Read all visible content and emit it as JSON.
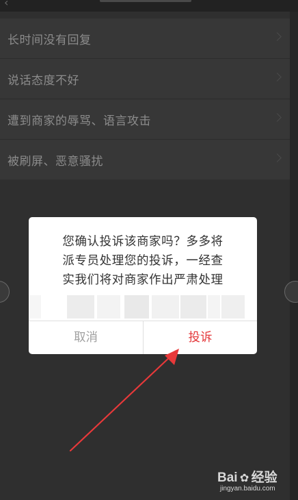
{
  "complaint_list": {
    "items": [
      {
        "label": "长时间没有回复"
      },
      {
        "label": "说话态度不好"
      },
      {
        "label": "遭到商家的辱骂、语言攻击"
      },
      {
        "label": "被刷屏、恶意骚扰"
      }
    ]
  },
  "dialog": {
    "message_lines": [
      "您确认投诉该商家吗？多多将",
      "派专员处理您的投诉，一经查",
      "实我们将对商家作出严肃处理"
    ],
    "cancel_label": "取消",
    "confirm_label": "投诉"
  },
  "colors": {
    "overlay_background": "#2f2f2f",
    "dialog_background": "#ffffff",
    "confirm_text": "#e4393c",
    "cancel_text": "#a0a0a0",
    "annotation_arrow": "#e8393a"
  },
  "watermark": {
    "brand": "Bai",
    "brand_suffix": "经验",
    "url": "jingyan.baidu.com"
  }
}
